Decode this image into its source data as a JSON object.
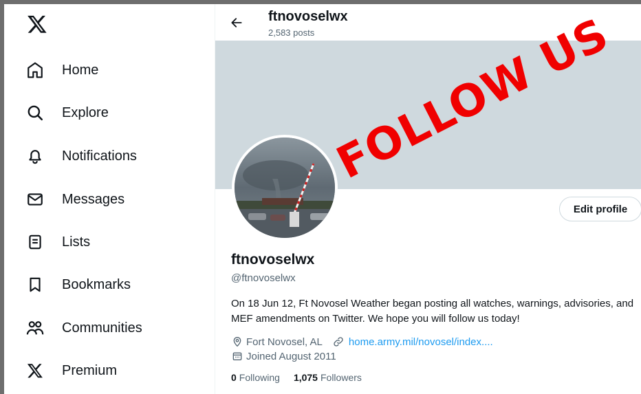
{
  "sidebar": {
    "logo_icon": "x-logo-icon",
    "items": [
      {
        "label": "Home",
        "icon": "home-icon"
      },
      {
        "label": "Explore",
        "icon": "search-icon"
      },
      {
        "label": "Notifications",
        "icon": "bell-icon"
      },
      {
        "label": "Messages",
        "icon": "envelope-icon"
      },
      {
        "label": "Lists",
        "icon": "list-icon"
      },
      {
        "label": "Bookmarks",
        "icon": "bookmark-icon"
      },
      {
        "label": "Communities",
        "icon": "people-icon"
      },
      {
        "label": "Premium",
        "icon": "x-logo-icon"
      }
    ]
  },
  "header": {
    "name": "ftnovoselwx",
    "posts": "2,583 posts"
  },
  "profile": {
    "display_name": "ftnovoselwx",
    "handle": "@ftnovoselwx",
    "bio": "On 18 Jun 12, Ft Novosel Weather began posting all watches, warnings, advisories, and MEF amendments on Twitter. We hope you will follow us today!",
    "location": "Fort Novosel, AL",
    "website": "home.army.mil/novosel/index....",
    "joined": "Joined August 2011",
    "following_count": "0",
    "following_label": "Following",
    "followers_count": "1,075",
    "followers_label": "Followers",
    "edit_label": "Edit profile"
  },
  "overlay": {
    "text": "FOLLOW US",
    "color": "#f00000"
  },
  "colors": {
    "banner": "#cfd9de",
    "link": "#1d9bf0",
    "secondary_text": "#536471"
  }
}
